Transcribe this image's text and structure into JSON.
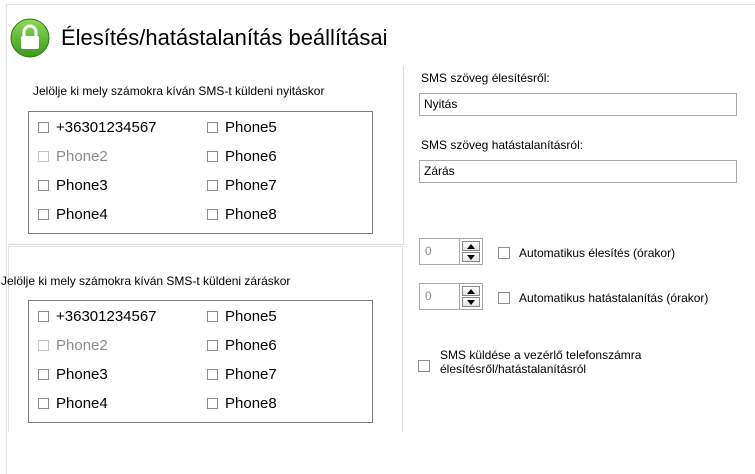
{
  "header": {
    "title": "Élesítés/hatástalanítás beállításai",
    "icon": "lock-icon"
  },
  "colors": {
    "icon_green": "#5fb82f",
    "icon_green_dark": "#3a8a1a"
  },
  "arming_group": {
    "label": "Jelölje ki mely számokra kíván SMS-t küldeni nyitáskor",
    "phones": [
      {
        "label": "+36301234567",
        "checked": false,
        "enabled": true
      },
      {
        "label": "Phone2",
        "checked": false,
        "enabled": false
      },
      {
        "label": "Phone3",
        "checked": false,
        "enabled": true
      },
      {
        "label": "Phone4",
        "checked": false,
        "enabled": true
      },
      {
        "label": "Phone5",
        "checked": false,
        "enabled": true
      },
      {
        "label": "Phone6",
        "checked": false,
        "enabled": true
      },
      {
        "label": "Phone7",
        "checked": false,
        "enabled": true
      },
      {
        "label": "Phone8",
        "checked": false,
        "enabled": true
      }
    ]
  },
  "disarming_group": {
    "label": "Jelölje ki mely számokra kíván SMS-t küldeni záráskor",
    "phones": [
      {
        "label": "+36301234567",
        "checked": false,
        "enabled": true
      },
      {
        "label": "Phone2",
        "checked": false,
        "enabled": false
      },
      {
        "label": "Phone3",
        "checked": false,
        "enabled": true
      },
      {
        "label": "Phone4",
        "checked": false,
        "enabled": true
      },
      {
        "label": "Phone5",
        "checked": false,
        "enabled": true
      },
      {
        "label": "Phone6",
        "checked": false,
        "enabled": true
      },
      {
        "label": "Phone7",
        "checked": false,
        "enabled": true
      },
      {
        "label": "Phone8",
        "checked": false,
        "enabled": true
      }
    ]
  },
  "sms_texts": {
    "arm_label": "SMS szöveg élesítésről:",
    "arm_value": "Nyitás",
    "disarm_label": "SMS szöveg hatástalanításról:",
    "disarm_value": "Zárás"
  },
  "auto_arm": {
    "value": "0",
    "label": "Automatikus élesítés (órakor)",
    "checked": false
  },
  "auto_disarm": {
    "value": "0",
    "label": "Automatikus hatástalanítás (órakor)",
    "checked": false
  },
  "sms_to_controller": {
    "label": "SMS küldése a vezérlő telefonszámra élesítésről/hatástalanításról",
    "checked": false
  }
}
